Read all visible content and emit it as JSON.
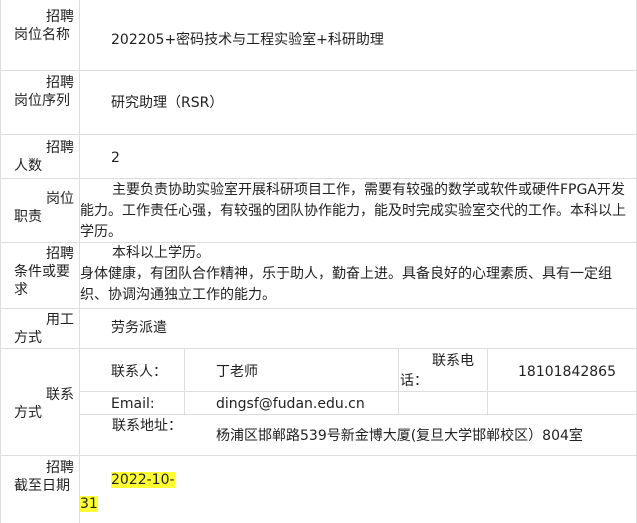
{
  "rows": {
    "position_name": {
      "label": "招聘岗位名称",
      "value": "202205+密码技术与工程实验室+科研助理"
    },
    "position_series": {
      "label": "招聘岗位序列",
      "value": "研究助理（RSR）"
    },
    "headcount": {
      "label": "招聘人数",
      "value": "2"
    },
    "duties": {
      "label": "岗位职责",
      "value": "主要负责协助实验室开展科研项目工作，需要有较强的数学或软件或硬件FPGA开发能力。工作责任心强，有较强的团队协作能力，能及时完成实验室交代的工作。本科以上学历。"
    },
    "requirements": {
      "label": "招聘条件或要求",
      "line1": "本科以上学历。",
      "line2": "身体健康，有团队合作精神，乐于助人，勤奋上进。具备良好的心理素质、具有一定组织、协调沟通独立工作的能力。"
    },
    "employment": {
      "label": "用工方式",
      "value": "劳务派遣"
    },
    "contact": {
      "label": "联系方式",
      "person_label": "联系人：",
      "person": "丁老师",
      "phone_label": "联系电话：",
      "phone": "18101842865",
      "email_label": "Email:",
      "email": "dingsf@fudan.edu.cn",
      "address_label": "联系地址：",
      "address": "杨浦区邯郸路539号新金博大厦(复旦大学邯郸校区）804室"
    },
    "deadline": {
      "label": "招聘截至日期",
      "value": "2022-10-31"
    }
  },
  "colors": {
    "highlight": "#ffff33",
    "border": "#dddddd"
  }
}
